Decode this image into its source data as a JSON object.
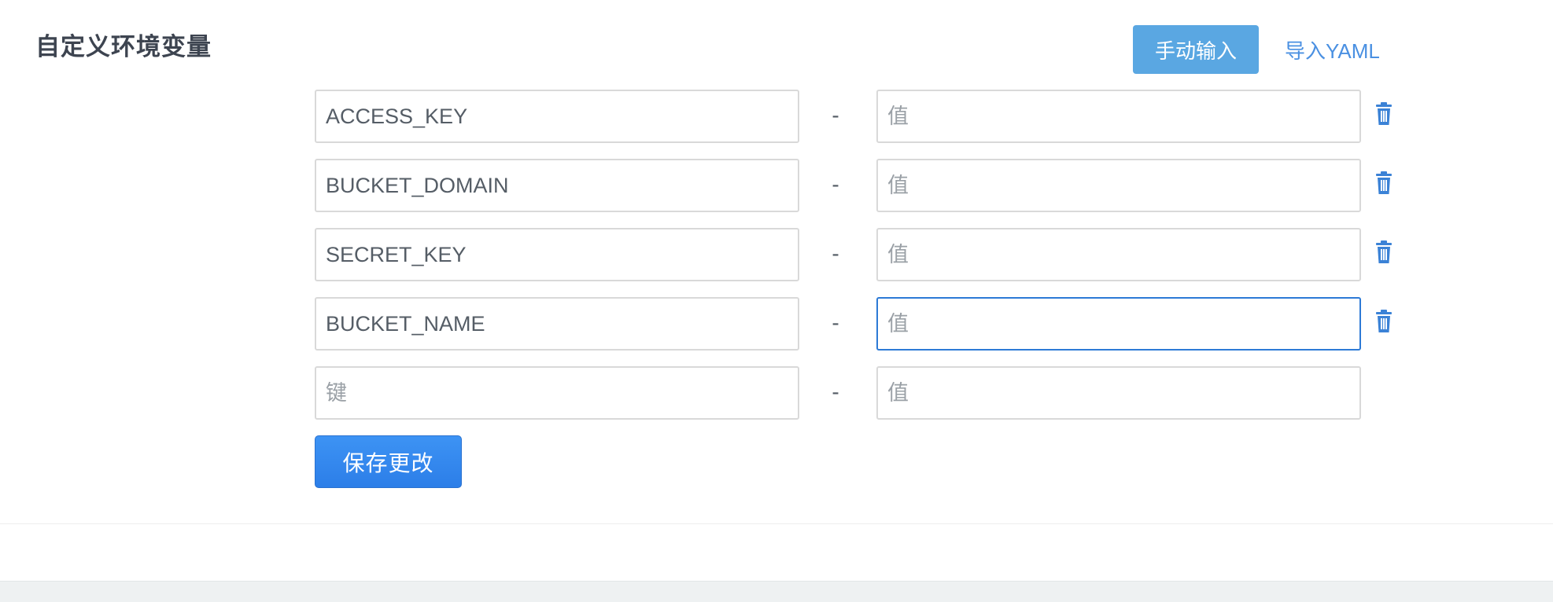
{
  "section": {
    "title": "自定义环境变量"
  },
  "mode_switch": {
    "manual_label": "手动输入",
    "import_label": "导入YAML"
  },
  "env_rows": [
    {
      "key": "ACCESS_KEY",
      "value": "",
      "key_placeholder": "键",
      "value_placeholder": "值",
      "separator": "-"
    },
    {
      "key": "BUCKET_DOMAIN",
      "value": "",
      "key_placeholder": "键",
      "value_placeholder": "值",
      "separator": "-"
    },
    {
      "key": "SECRET_KEY",
      "value": "",
      "key_placeholder": "键",
      "value_placeholder": "值",
      "separator": "-"
    },
    {
      "key": "BUCKET_NAME",
      "value": "",
      "key_placeholder": "键",
      "value_placeholder": "值",
      "separator": "-"
    },
    {
      "key": "",
      "value": "",
      "key_placeholder": "键",
      "value_placeholder": "值",
      "separator": "-"
    }
  ],
  "actions": {
    "save_label": "保存更改"
  },
  "icons": {
    "delete": "trash-icon"
  },
  "colors": {
    "primary": "#2c7ee8",
    "manual_button": "#5aa7e2",
    "link": "#4a90e2",
    "focus_border": "#2d7ad6"
  }
}
